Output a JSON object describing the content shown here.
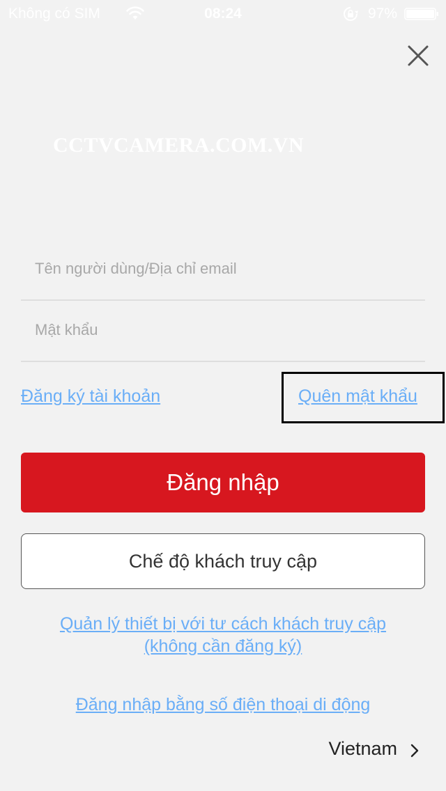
{
  "status_bar": {
    "carrier": "Không có SIM",
    "time": "08:24",
    "battery_percent": "97%",
    "icons": [
      "wifi-icon",
      "rotation-lock-icon",
      "battery-icon"
    ]
  },
  "close_icon": "close-icon",
  "watermark": "CCTVCAMERA.COM.VN",
  "form": {
    "username_placeholder": "Tên người dùng/Địa chỉ email",
    "username_value": "",
    "password_placeholder": "Mật khẩu",
    "password_value": ""
  },
  "links": {
    "register": "Đăng ký tài khoản",
    "forgot_password": "Quên mật khẩu"
  },
  "buttons": {
    "login": "Đăng nhập",
    "guest_mode": "Chế độ khách truy cập"
  },
  "guest_manage": {
    "line1": "Quản lý thiết bị với tư cách khách truy cập",
    "line2": "(không cần đăng ký)"
  },
  "phone_login": "Đăng nhập bằng số điện thoại di động",
  "region": {
    "label": "Vietnam",
    "icon": "chevron-right-icon"
  },
  "colors": {
    "background": "#f2f2f2",
    "primary_red": "#d7171f",
    "link_blue": "#6aaef7",
    "highlight_border": "#000000"
  }
}
